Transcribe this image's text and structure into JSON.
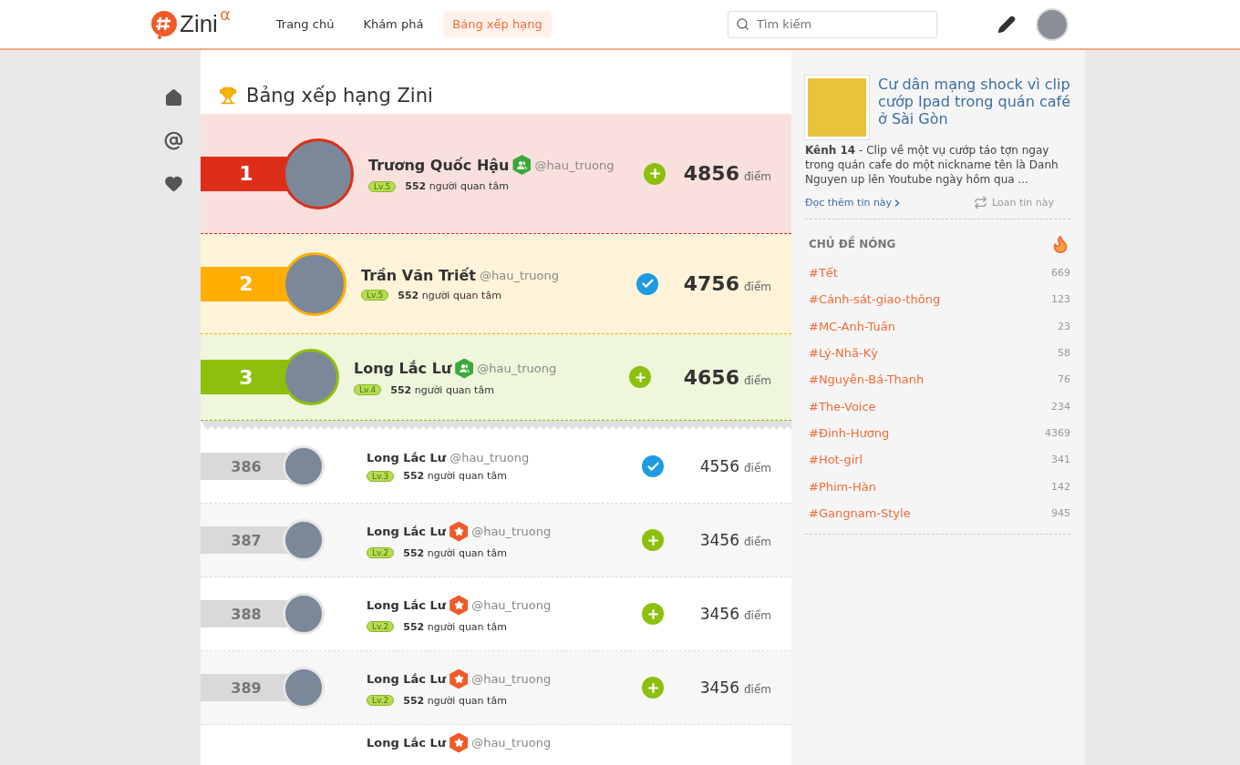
{
  "header": {
    "logo": {
      "name": "Zini",
      "sup": "α"
    },
    "nav": [
      {
        "label": "Trang chủ",
        "selected": false
      },
      {
        "label": "Khám phá",
        "selected": false
      },
      {
        "label": "Bảng xếp hạng",
        "selected": true
      }
    ],
    "search": {
      "placeholder": "Tìm kiếm"
    }
  },
  "sidebar": {
    "items": [
      {
        "kind": "home"
      },
      {
        "kind": "mention"
      },
      {
        "kind": "heart"
      }
    ]
  },
  "ranking": {
    "title": "Bảng xếp hạng Zini",
    "rows": [
      {
        "kind": "top",
        "rank": "1",
        "color": "#dd2e1a",
        "name": "Trương Quốc Hậu",
        "badge": {
          "kind": "group"
        },
        "handle": "@hau_truong",
        "level": "Lv.5",
        "followers": "552",
        "followers_label": "người quan tâm",
        "followed": false,
        "score": "4856",
        "unit": "điểm"
      },
      {
        "kind": "top",
        "rank": "2",
        "color": "#ffad00",
        "name": "Trần Văn Triết",
        "handle": "@hau_truong",
        "level": "Lv.5",
        "followers": "552",
        "followers_label": "người quan tâm",
        "followed": true,
        "score": "4756",
        "unit": "điểm"
      },
      {
        "kind": "top",
        "rank": "3",
        "color": "#8cc00c",
        "name": "Long Lắc Lư",
        "badge": {
          "kind": "group"
        },
        "handle": "@hau_truong",
        "level": "Lv.4",
        "followers": "552",
        "followers_label": "người quan tâm",
        "followed": false,
        "score": "4656",
        "unit": "điểm"
      },
      {
        "kind": "normal",
        "rank": "386",
        "name": "Long Lắc Lư",
        "handle": "@hau_truong",
        "level": "Lv.3",
        "followers": "552",
        "followers_label": "người quan tâm",
        "followed": true,
        "score": "4556",
        "unit": "điểm"
      },
      {
        "kind": "normal",
        "rank": "387",
        "name": "Long Lắc Lư",
        "badge": {
          "kind": "star"
        },
        "handle": "@hau_truong",
        "level": "Lv.2",
        "followers": "552",
        "followers_label": "người quan tâm",
        "followed": false,
        "score": "3456",
        "unit": "điểm"
      },
      {
        "kind": "normal",
        "rank": "388",
        "name": "Long Lắc Lư",
        "badge": {
          "kind": "star"
        },
        "handle": "@hau_truong",
        "level": "Lv.2",
        "followers": "552",
        "followers_label": "người quan tâm",
        "followed": false,
        "score": "3456",
        "unit": "điểm"
      },
      {
        "kind": "normal",
        "rank": "389",
        "name": "Long Lắc Lư",
        "badge": {
          "kind": "star"
        },
        "handle": "@hau_truong",
        "level": "Lv.2",
        "followers": "552",
        "followers_label": "người quan tâm",
        "followed": false,
        "score": "3456",
        "unit": "điểm"
      },
      {
        "kind": "partial",
        "name": "Long Lắc Lư",
        "badge": {
          "kind": "star"
        },
        "handle": "@hau_truong"
      }
    ]
  },
  "news": {
    "title": "Cư dân mạng shock vì clip cướp Ipad trong quán café ở Sài Gòn",
    "summary": "**Kênh 14** - Clip về một vụ cướp táo tợn ngay trong quán cafe do một nickname tên là Danh Nguyen up lên Youtube ngày hôm qua ...",
    "read_more": "Đọc thêm tin này",
    "share": "Loan tin này"
  },
  "hot_topics": {
    "title": "CHỦ ĐỀ NÓNG",
    "items": [
      {
        "tag": "#Tết",
        "count": "669"
      },
      {
        "tag": "#Cảnh-sát-giao-thông",
        "count": "123"
      },
      {
        "tag": "#MC-Anh-Tuấn",
        "count": "23"
      },
      {
        "tag": "#Lý-Nhã-Kỳ",
        "count": "58"
      },
      {
        "tag": "#Nguyễn-Bá-Thanh",
        "count": "76"
      },
      {
        "tag": "#The-Voice",
        "count": "234"
      },
      {
        "tag": "#Đinh-Hương",
        "count": "4369"
      },
      {
        "tag": "#Hot-girl",
        "count": "341"
      },
      {
        "tag": "#Phim-Hàn",
        "count": "142"
      },
      {
        "tag": "#Gangnam-Style",
        "count": "945"
      }
    ]
  }
}
